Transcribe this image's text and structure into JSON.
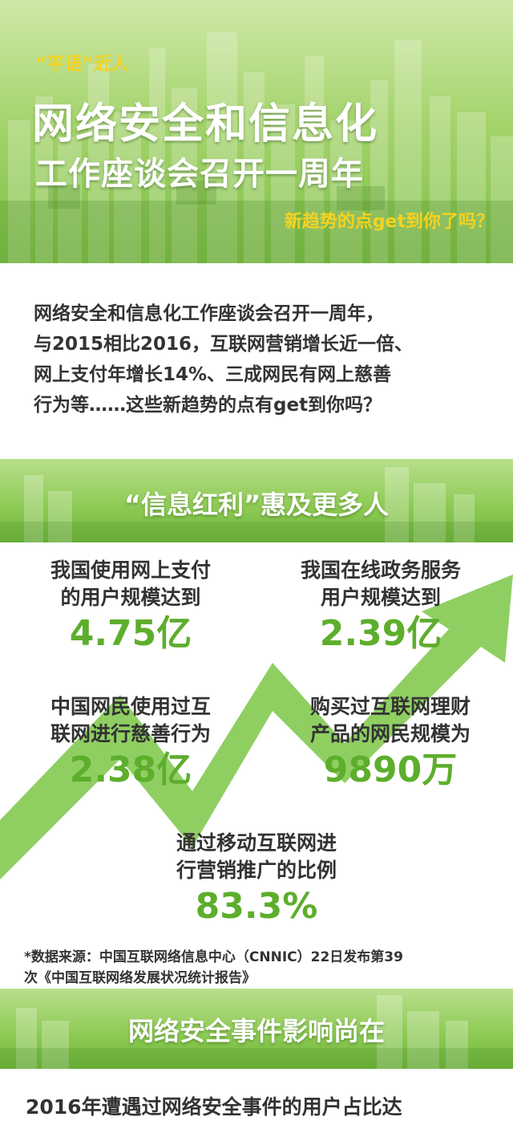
{
  "header": {
    "tag": "“平语”近人",
    "title_line1": "网络安全和信息化",
    "title_line2": "工作座谈会召开一周年",
    "subtitle": "新趋势的点get到你了吗？"
  },
  "intro": {
    "lines": [
      "网络安全和信息化工作座谈会召开一周年，",
      "与2015相比2016，互联网营销增长近一倍、",
      "网上支付年增长14%、三成网民有网上慈善",
      "行为等……这些新趋势的点有get到你吗？"
    ]
  },
  "section1": {
    "title": "“信息红利”惠及更多人"
  },
  "stats": [
    {
      "label_line1": "我国使用网上支付",
      "label_line2": "的用户规模达到",
      "value": "4.75亿"
    },
    {
      "label_line1": "我国在线政务服务",
      "label_line2": "用户规模达到",
      "value": "2.39亿"
    },
    {
      "label_line1": "中国网民使用过互",
      "label_line2": "联网进行慈善行为",
      "value": "2.38亿"
    },
    {
      "label_line1": "购买过互联网理财",
      "label_line2": "产品的网民规模为",
      "value": "9890万"
    },
    {
      "label_line1": "通过移动互联网进",
      "label_line2": "行营销推广的比例",
      "value": "83.3%"
    }
  ],
  "source": {
    "line1": "*数据来源：中国互联网络信息中心（CNNIC）22日发布第39",
    "line2": "次《中国互联网络发展状况统计报告》"
  },
  "section2": {
    "title": "网络安全事件影响尚在"
  },
  "bottom": {
    "text": "2016年遭遇过网络安全事件的用户占比达"
  },
  "colors": {
    "accent_green": "#5dae2c",
    "arrow_green": "#8fcf62",
    "banner_green": "#8fcb56",
    "highlight_yellow": "#f6d21f"
  }
}
